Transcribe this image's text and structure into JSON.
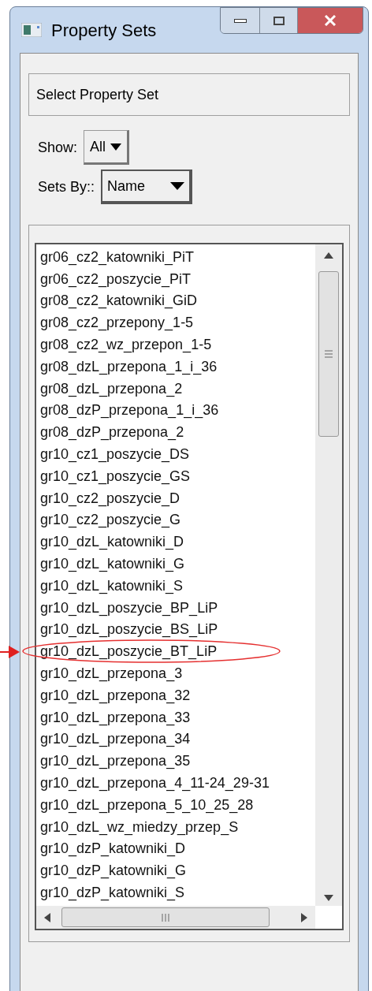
{
  "window": {
    "title": "Property Sets"
  },
  "header": "Select Property Set",
  "show": {
    "label": "Show:",
    "value": "All"
  },
  "sets_by": {
    "label": "Sets By::",
    "value": "Name"
  },
  "list": {
    "items": [
      {
        "label": "gr06_cz2_katowniki_PiT",
        "circled": false
      },
      {
        "label": "gr06_cz2_poszycie_PiT",
        "circled": false
      },
      {
        "label": "gr08_cz2_katowniki_GiD",
        "circled": false
      },
      {
        "label": "gr08_cz2_przepony_1-5",
        "circled": false
      },
      {
        "label": "gr08_cz2_wz_przepon_1-5",
        "circled": false
      },
      {
        "label": "gr08_dzL_przepona_1_i_36",
        "circled": false
      },
      {
        "label": "gr08_dzL_przepona_2",
        "circled": false
      },
      {
        "label": "gr08_dzP_przepona_1_i_36",
        "circled": false
      },
      {
        "label": "gr08_dzP_przepona_2",
        "circled": false
      },
      {
        "label": "gr10_cz1_poszycie_DS",
        "circled": false
      },
      {
        "label": "gr10_cz1_poszycie_GS",
        "circled": false
      },
      {
        "label": "gr10_cz2_poszycie_D",
        "circled": false
      },
      {
        "label": "gr10_cz2_poszycie_G",
        "circled": false
      },
      {
        "label": "gr10_dzL_katowniki_D",
        "circled": false
      },
      {
        "label": "gr10_dzL_katowniki_G",
        "circled": false
      },
      {
        "label": "gr10_dzL_katowniki_S",
        "circled": false
      },
      {
        "label": "gr10_dzL_poszycie_BP_LiP",
        "circled": false
      },
      {
        "label": "gr10_dzL_poszycie_BS_LiP",
        "circled": false
      },
      {
        "label": "gr10_dzL_poszycie_BT_LiP",
        "circled": true
      },
      {
        "label": "gr10_dzL_przepona_3",
        "circled": false
      },
      {
        "label": "gr10_dzL_przepona_32",
        "circled": false
      },
      {
        "label": "gr10_dzL_przepona_33",
        "circled": false
      },
      {
        "label": "gr10_dzL_przepona_34",
        "circled": false
      },
      {
        "label": "gr10_dzL_przepona_35",
        "circled": false
      },
      {
        "label": "gr10_dzL_przepona_4_11-24_29-31",
        "circled": false
      },
      {
        "label": "gr10_dzL_przepona_5_10_25_28",
        "circled": false
      },
      {
        "label": "gr10_dzL_wz_miedzy_przep_S",
        "circled": false
      },
      {
        "label": "gr10_dzP_katowniki_D",
        "circled": false
      },
      {
        "label": "gr10_dzP_katowniki_G",
        "circled": false
      },
      {
        "label": "gr10_dzP_katowniki_S",
        "circled": false
      }
    ]
  }
}
